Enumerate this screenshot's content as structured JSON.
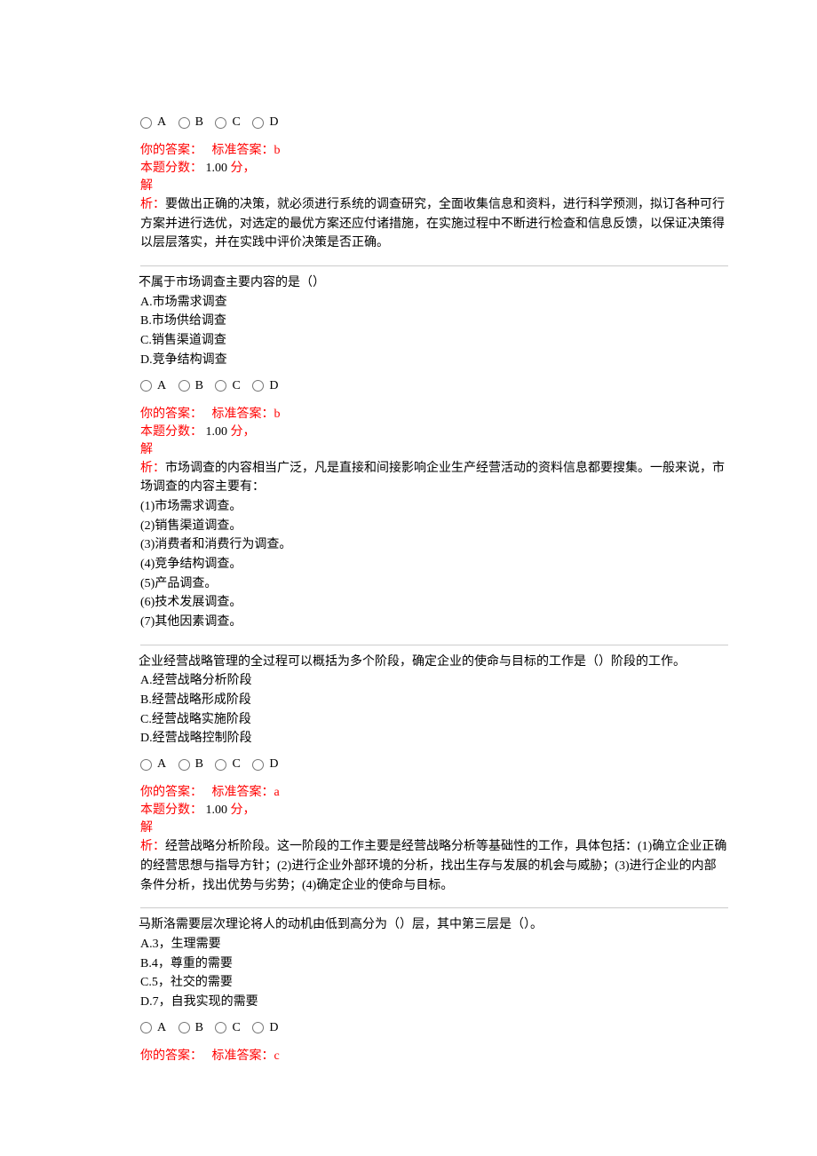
{
  "radio_labels": {
    "a": "A",
    "b": "B",
    "c": "C",
    "d": "D"
  },
  "labels": {
    "your_answer": "你的答案：",
    "std_answer_prefix": "标准答案：",
    "score_label": "本题分数：",
    "score_unit": "分，",
    "jie": "解",
    "xi_prefix": "析："
  },
  "q1": {
    "ans": {
      "std": "b",
      "score": "1.00 "
    },
    "analysis": "要做出正确的决策，就必须进行系统的调查研究，全面收集信息和资料，进行科学预测，拟订各种可行方案并进行选优，对选定的最优方案还应付诸措施，在实施过程中不断进行检查和信息反馈，以保证决策得以层层落实，并在实践中评价决策是否正确。"
  },
  "q2": {
    "stem": "不属于市场调查主要内容的是（）",
    "opts": {
      "a": "A.市场需求调查",
      "b": "B.市场供给调查",
      "c": "C.销售渠道调查",
      "d": "D.竞争结构调查"
    },
    "ans": {
      "std": "b",
      "score": "1.00 "
    },
    "analysis_lead": "市场调查的内容相当广泛，凡是直接和间接影响企业生产经营活动的资料信息都要搜集。一般来说，市场调查的内容主要有：",
    "list": [
      "(1)市场需求调查。",
      "(2)销售渠道调查。",
      "(3)消费者和消费行为调查。",
      "(4)竞争结构调查。",
      "(5)产品调查。",
      "(6)技术发展调查。",
      "(7)其他因素调查。"
    ]
  },
  "q3": {
    "stem": "企业经营战略管理的全过程可以概括为多个阶段，确定企业的使命与目标的工作是（）阶段的工作。",
    "opts": {
      "a": "A.经营战略分析阶段",
      "b": "B.经营战略形成阶段",
      "c": "C.经营战略实施阶段",
      "d": "D.经营战略控制阶段"
    },
    "ans": {
      "std": "a",
      "score": "1.00 "
    },
    "analysis": "经营战略分析阶段。这一阶段的工作主要是经营战略分析等基础性的工作，具体包括：(1)确立企业正确的经营思想与指导方针；(2)进行企业外部环境的分析，找出生存与发展的机会与威胁；(3)进行企业的内部条件分析，找出优势与劣势；(4)确定企业的使命与目标。"
  },
  "q4": {
    "stem": "马斯洛需要层次理论将人的动机由低到高分为（）层，其中第三层是（）。",
    "opts": {
      "a": "A.3，生理需要",
      "b": "B.4，尊重的需要",
      "c": "C.5，社交的需要",
      "d": "D.7，自我实现的需要"
    },
    "ans": {
      "std": "c"
    }
  }
}
